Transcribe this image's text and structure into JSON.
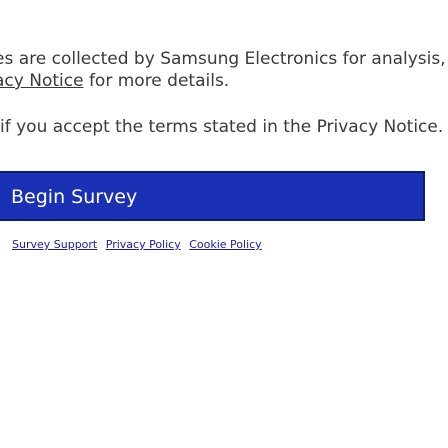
{
  "intro": {
    "line1": "es are collected by Samsung Electronics for analysis, to be",
    "line2_link": "acy Notice",
    "line2_rest": " for more details."
  },
  "consent_text": "if you accept the terms stated in the Privacy Notice.",
  "begin_button": {
    "label": "Begin Survey",
    "color": "#1a31b6"
  },
  "footer_links": [
    "Survey Support",
    "Privacy Policy",
    "Cookie Policy"
  ]
}
